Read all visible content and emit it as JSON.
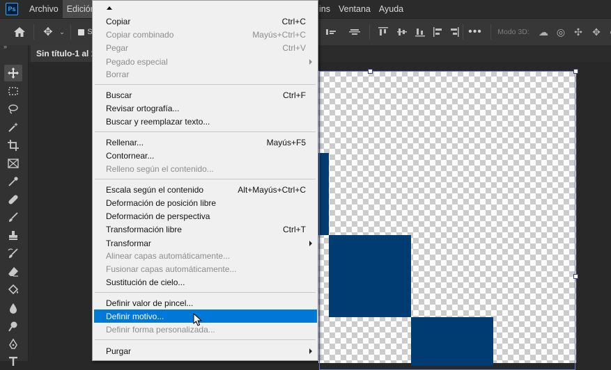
{
  "app": {
    "logo_text": "Ps",
    "menu": [
      "Archivo",
      "Edición",
      "ins",
      "Ventana",
      "Ayuda"
    ],
    "active_menu": "Edición"
  },
  "options_bar": {
    "autoselect_label": "S",
    "mode3d_label": "Modo 3D:"
  },
  "document": {
    "tab_title": "Sin título-1 al 1"
  },
  "canvas": {
    "fill_color": "#003c71"
  },
  "edit_menu": {
    "items": [
      {
        "label": "Copiar",
        "shortcut": "Ctrl+C"
      },
      {
        "label": "Copiar combinado",
        "shortcut": "Mayús+Ctrl+C"
      },
      {
        "label": "Pegar",
        "shortcut": "Ctrl+V"
      },
      {
        "label": "Pegado especial",
        "shortcut": ""
      },
      {
        "label": "Borrar",
        "shortcut": ""
      },
      {
        "label": "Buscar",
        "shortcut": "Ctrl+F"
      },
      {
        "label": "Revisar ortografía...",
        "shortcut": ""
      },
      {
        "label": "Buscar y reemplazar texto...",
        "shortcut": ""
      },
      {
        "label": "Rellenar...",
        "shortcut": "Mayús+F5"
      },
      {
        "label": "Contornear...",
        "shortcut": ""
      },
      {
        "label": "Relleno según el contenido...",
        "shortcut": ""
      },
      {
        "label": "Escala según el contenido",
        "shortcut": "Alt+Mayús+Ctrl+C"
      },
      {
        "label": "Deformación de posición libre",
        "shortcut": ""
      },
      {
        "label": "Deformación de perspectiva",
        "shortcut": ""
      },
      {
        "label": "Transformación libre",
        "shortcut": "Ctrl+T"
      },
      {
        "label": "Transformar",
        "shortcut": ""
      },
      {
        "label": "Alinear capas automáticamente...",
        "shortcut": ""
      },
      {
        "label": "Fusionar capas automáticamente...",
        "shortcut": ""
      },
      {
        "label": "Sustitución de cielo...",
        "shortcut": ""
      },
      {
        "label": "Definir valor de pincel...",
        "shortcut": ""
      },
      {
        "label": "Definir motivo...",
        "shortcut": ""
      },
      {
        "label": "Definir forma personalizada...",
        "shortcut": ""
      },
      {
        "label": "Purgar",
        "shortcut": ""
      }
    ],
    "highlighted": "Definir motivo..."
  },
  "colors": {
    "menu_highlight": "#0078d7",
    "shape_fill": "#003c71"
  }
}
